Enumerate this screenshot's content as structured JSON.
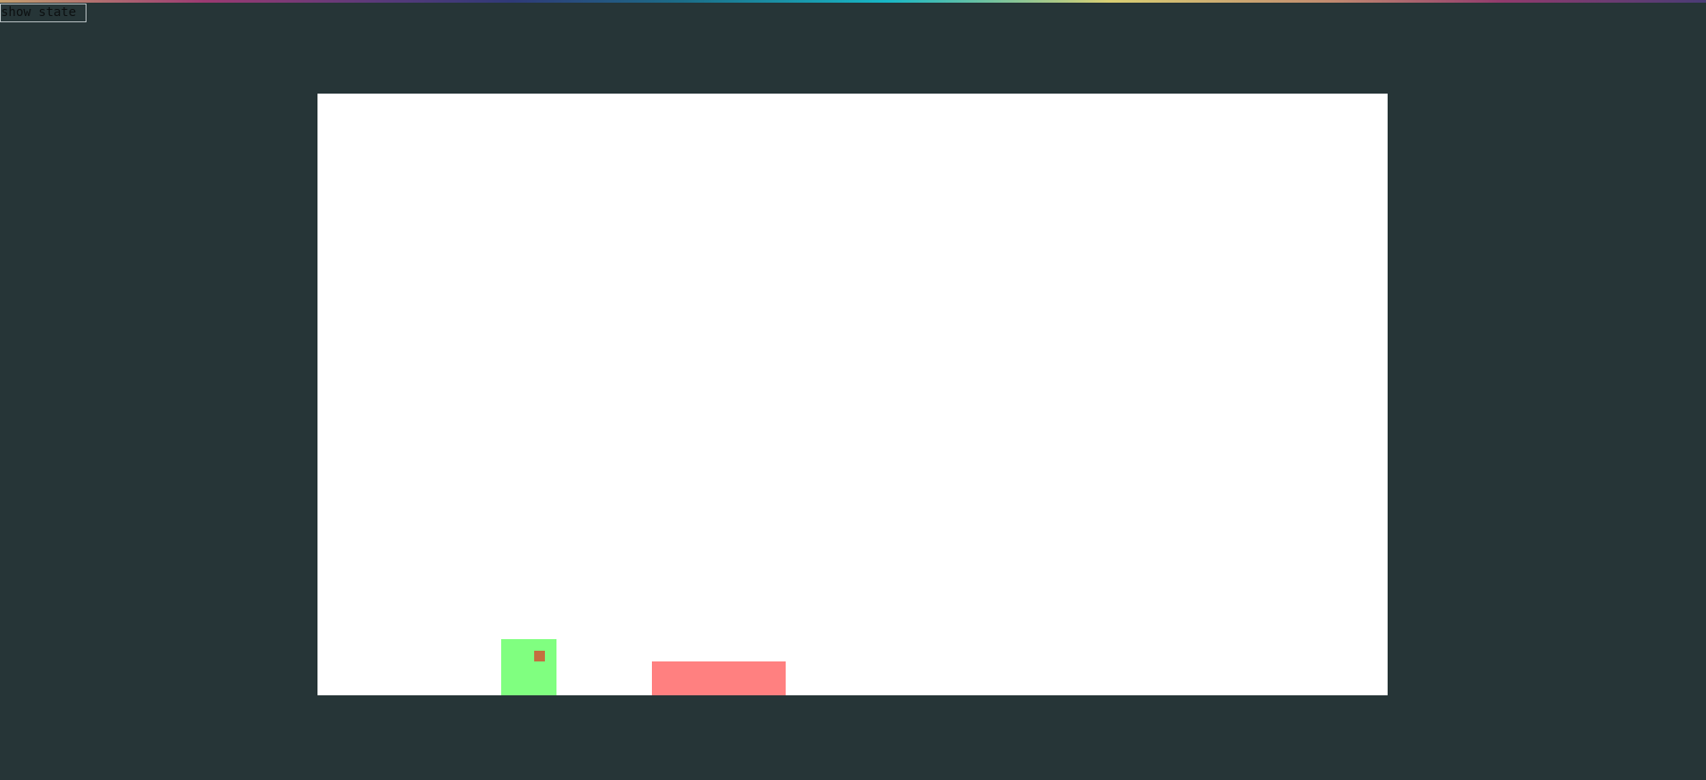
{
  "controls": {
    "show_state_label": "show state"
  },
  "game": {
    "colors": {
      "background": "#263537",
      "canvas": "#ffffff",
      "player": "#80ff80",
      "player_marker": "#c46f3f",
      "obstacle": "#ff8080"
    }
  }
}
